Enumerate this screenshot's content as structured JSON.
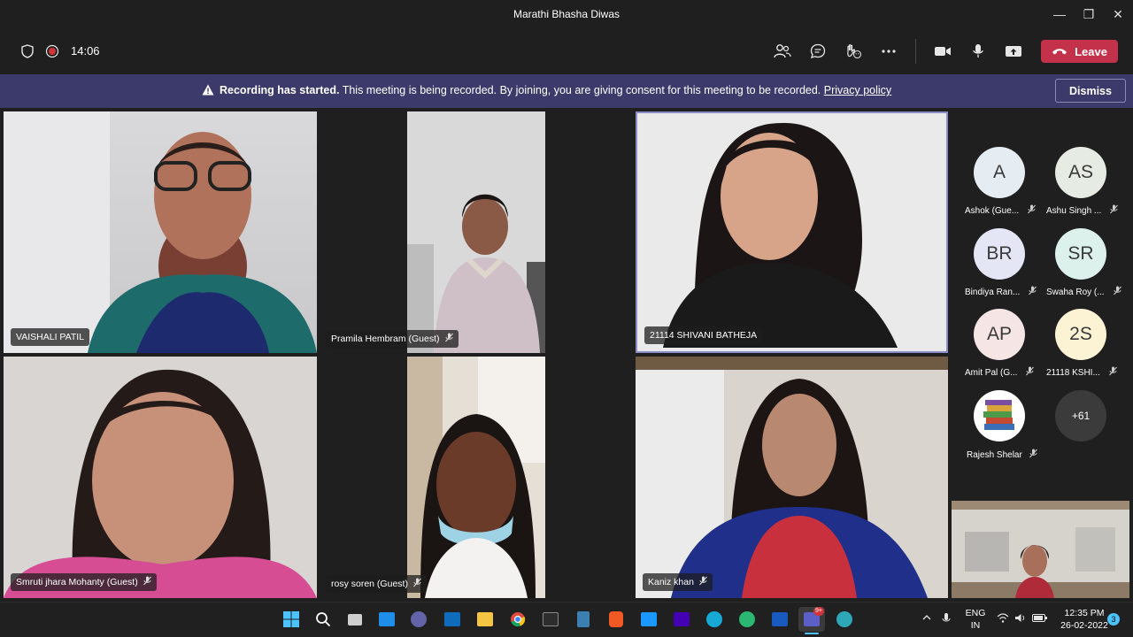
{
  "window": {
    "title": "Marathi Bhasha Diwas",
    "minimize": "—",
    "maximize": "❐",
    "close": "✕"
  },
  "toolbar": {
    "timer": "14:06",
    "leave_label": "Leave"
  },
  "banner": {
    "bold": "Recording has started.",
    "text": "This meeting is being recorded. By joining, you are giving consent for this meeting to be recorded.",
    "link": "Privacy policy",
    "dismiss_label": "Dismiss"
  },
  "tiles": [
    {
      "name": "VAISHALI PATIL",
      "muted": false
    },
    {
      "name": "Pramila Hembram (Guest)",
      "muted": true
    },
    {
      "name": "21114 SHIVANI BATHEJA",
      "muted": false,
      "active_speaker": true
    },
    {
      "name": "Smruti jhara Mohanty (Guest)",
      "muted": true
    },
    {
      "name": "rosy soren (Guest)",
      "muted": true
    },
    {
      "name": "Kaniz khan",
      "muted": true
    }
  ],
  "roster": [
    {
      "initials": "A",
      "name": "Ashok (Gue...",
      "color": "#e6edf2"
    },
    {
      "initials": "AS",
      "name": "Ashu Singh ...",
      "color": "#e6ebe3"
    },
    {
      "initials": "BR",
      "name": "Bindiya Ran...",
      "color": "#e4e6f5"
    },
    {
      "initials": "SR",
      "name": "Swaha Roy (...",
      "color": "#dcf1ec"
    },
    {
      "initials": "AP",
      "name": "Amit Pal (G...",
      "color": "#f5e5e5"
    },
    {
      "initials": "2S",
      "name": "21118 KSHI...",
      "color": "#fbf3d4"
    },
    {
      "initials": "",
      "name": "Rajesh Shelar",
      "color": "#ffffff"
    }
  ],
  "overflow_count": "+61",
  "taskbar": {
    "lang_line1": "ENG",
    "lang_line2": "IN",
    "time": "12:35 PM",
    "date": "26-02-2022",
    "notification_count": "3",
    "teams_badge": "9+"
  },
  "colors": {
    "leave": "#c4314b",
    "banner": "#3b3a6a",
    "accent": "#6264a7"
  }
}
